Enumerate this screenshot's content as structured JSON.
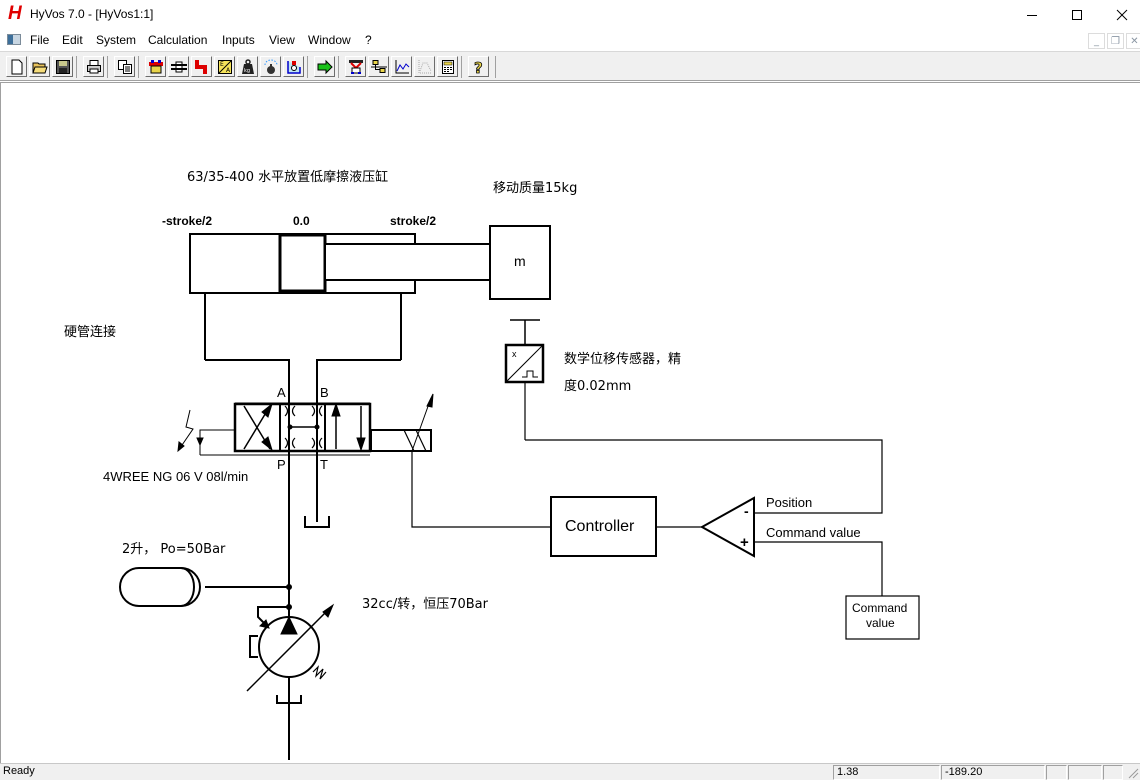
{
  "window": {
    "title": "HyVos 7.0 - [HyVos1:1]",
    "logo_letter": "H",
    "controls": {
      "minimize": "minimize",
      "maximize": "maximize",
      "close": "close"
    }
  },
  "menubar": {
    "items": [
      "File",
      "Edit",
      "System",
      "Calculation",
      "Inputs",
      "View",
      "Window",
      "?"
    ]
  },
  "toolbar": {
    "buttons": [
      "new-document",
      "open-folder",
      "save-disk",
      "print",
      "copy",
      "cylinder-component",
      "valve-component",
      "pipe-component",
      "converter-component",
      "mass-component",
      "sensor-component",
      "tank-component",
      "run-simulation",
      "pump-component",
      "controller-component",
      "plot-chart",
      "plot-disabled",
      "calculator",
      "help"
    ]
  },
  "diagram": {
    "cylinder_title": "63/35-400 水平放置低摩擦液压缸",
    "moving_mass": "移动质量15kg",
    "stroke_left": "-stroke/2",
    "stroke_center": "0.0",
    "stroke_right": "stroke/2",
    "mass_label": "m",
    "pipe_note": "硬管连接",
    "sensor_note_line1": "数学位移传感器，精",
    "sensor_note_line2": "度0.02mm",
    "sensor_glyph": "x",
    "port_a": "A",
    "port_b": "B",
    "port_p": "P",
    "port_t": "T",
    "valve_label": "4WREE NG 06 V 08l/min",
    "controller_label": "Controller",
    "position_label": "Position",
    "command_value_label": "Command value",
    "summing_minus": "-",
    "summing_plus": "+",
    "command_block_line1": "Command",
    "command_block_line2": "value",
    "accumulator_label": "2升， Po=50Bar",
    "pump_label": "32cc/转，恒压70Bar"
  },
  "statusbar": {
    "status": "Ready",
    "value1": "1.38",
    "value2": "-189.20"
  }
}
